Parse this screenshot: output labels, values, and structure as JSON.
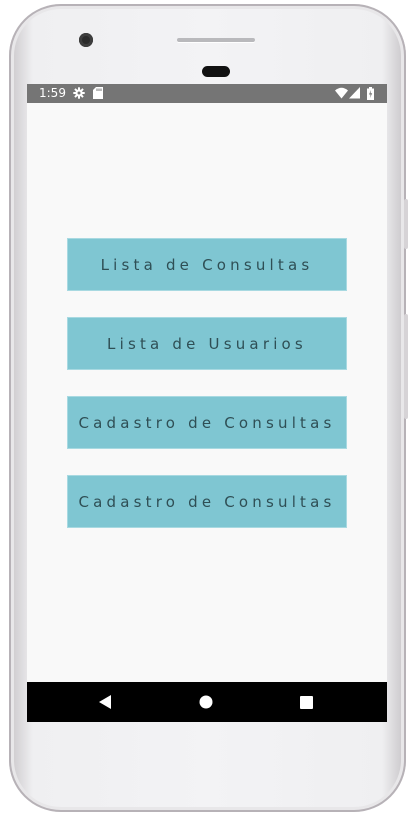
{
  "status_bar": {
    "time": "1:59",
    "icons_left": [
      "gear-icon",
      "sd-card-icon"
    ],
    "icons_right": [
      "wifi-icon",
      "signal-icon",
      "battery-icon"
    ]
  },
  "menu": {
    "buttons": [
      {
        "label": "Lista de Consultas"
      },
      {
        "label": "Lista de Usuarios"
      },
      {
        "label": "Cadastro de Consultas"
      },
      {
        "label": "Cadastro de Consultas"
      }
    ]
  },
  "nav_bar": {
    "items": [
      "back-icon",
      "home-icon",
      "recents-icon"
    ]
  },
  "colors": {
    "button_bg": "#7fc6d2",
    "screen_bg": "#f9f9f9",
    "status_bar_bg": "#757575",
    "nav_bar_bg": "#000000"
  }
}
